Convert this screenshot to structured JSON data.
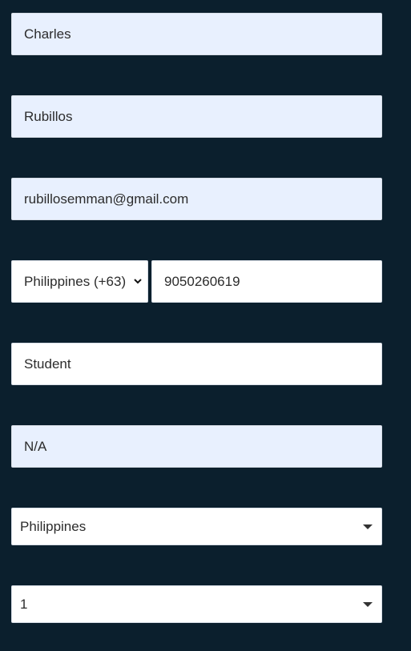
{
  "form": {
    "first_name": "Charles",
    "last_name": "Rubillos",
    "email": "rubillosemman@gmail.com",
    "phone": {
      "country_code": "Philippines (+63)",
      "number": "9050260619"
    },
    "job_title": "Student",
    "company": "N/A",
    "country": "Philippines",
    "count": "1"
  },
  "colors": {
    "background": "#0b1f2d",
    "autofill_field": "#e8f0fe",
    "field": "#ffffff"
  },
  "icons": {
    "select_chevron": "chevron-down-icon",
    "dropdown_caret": "caret-down-icon"
  }
}
